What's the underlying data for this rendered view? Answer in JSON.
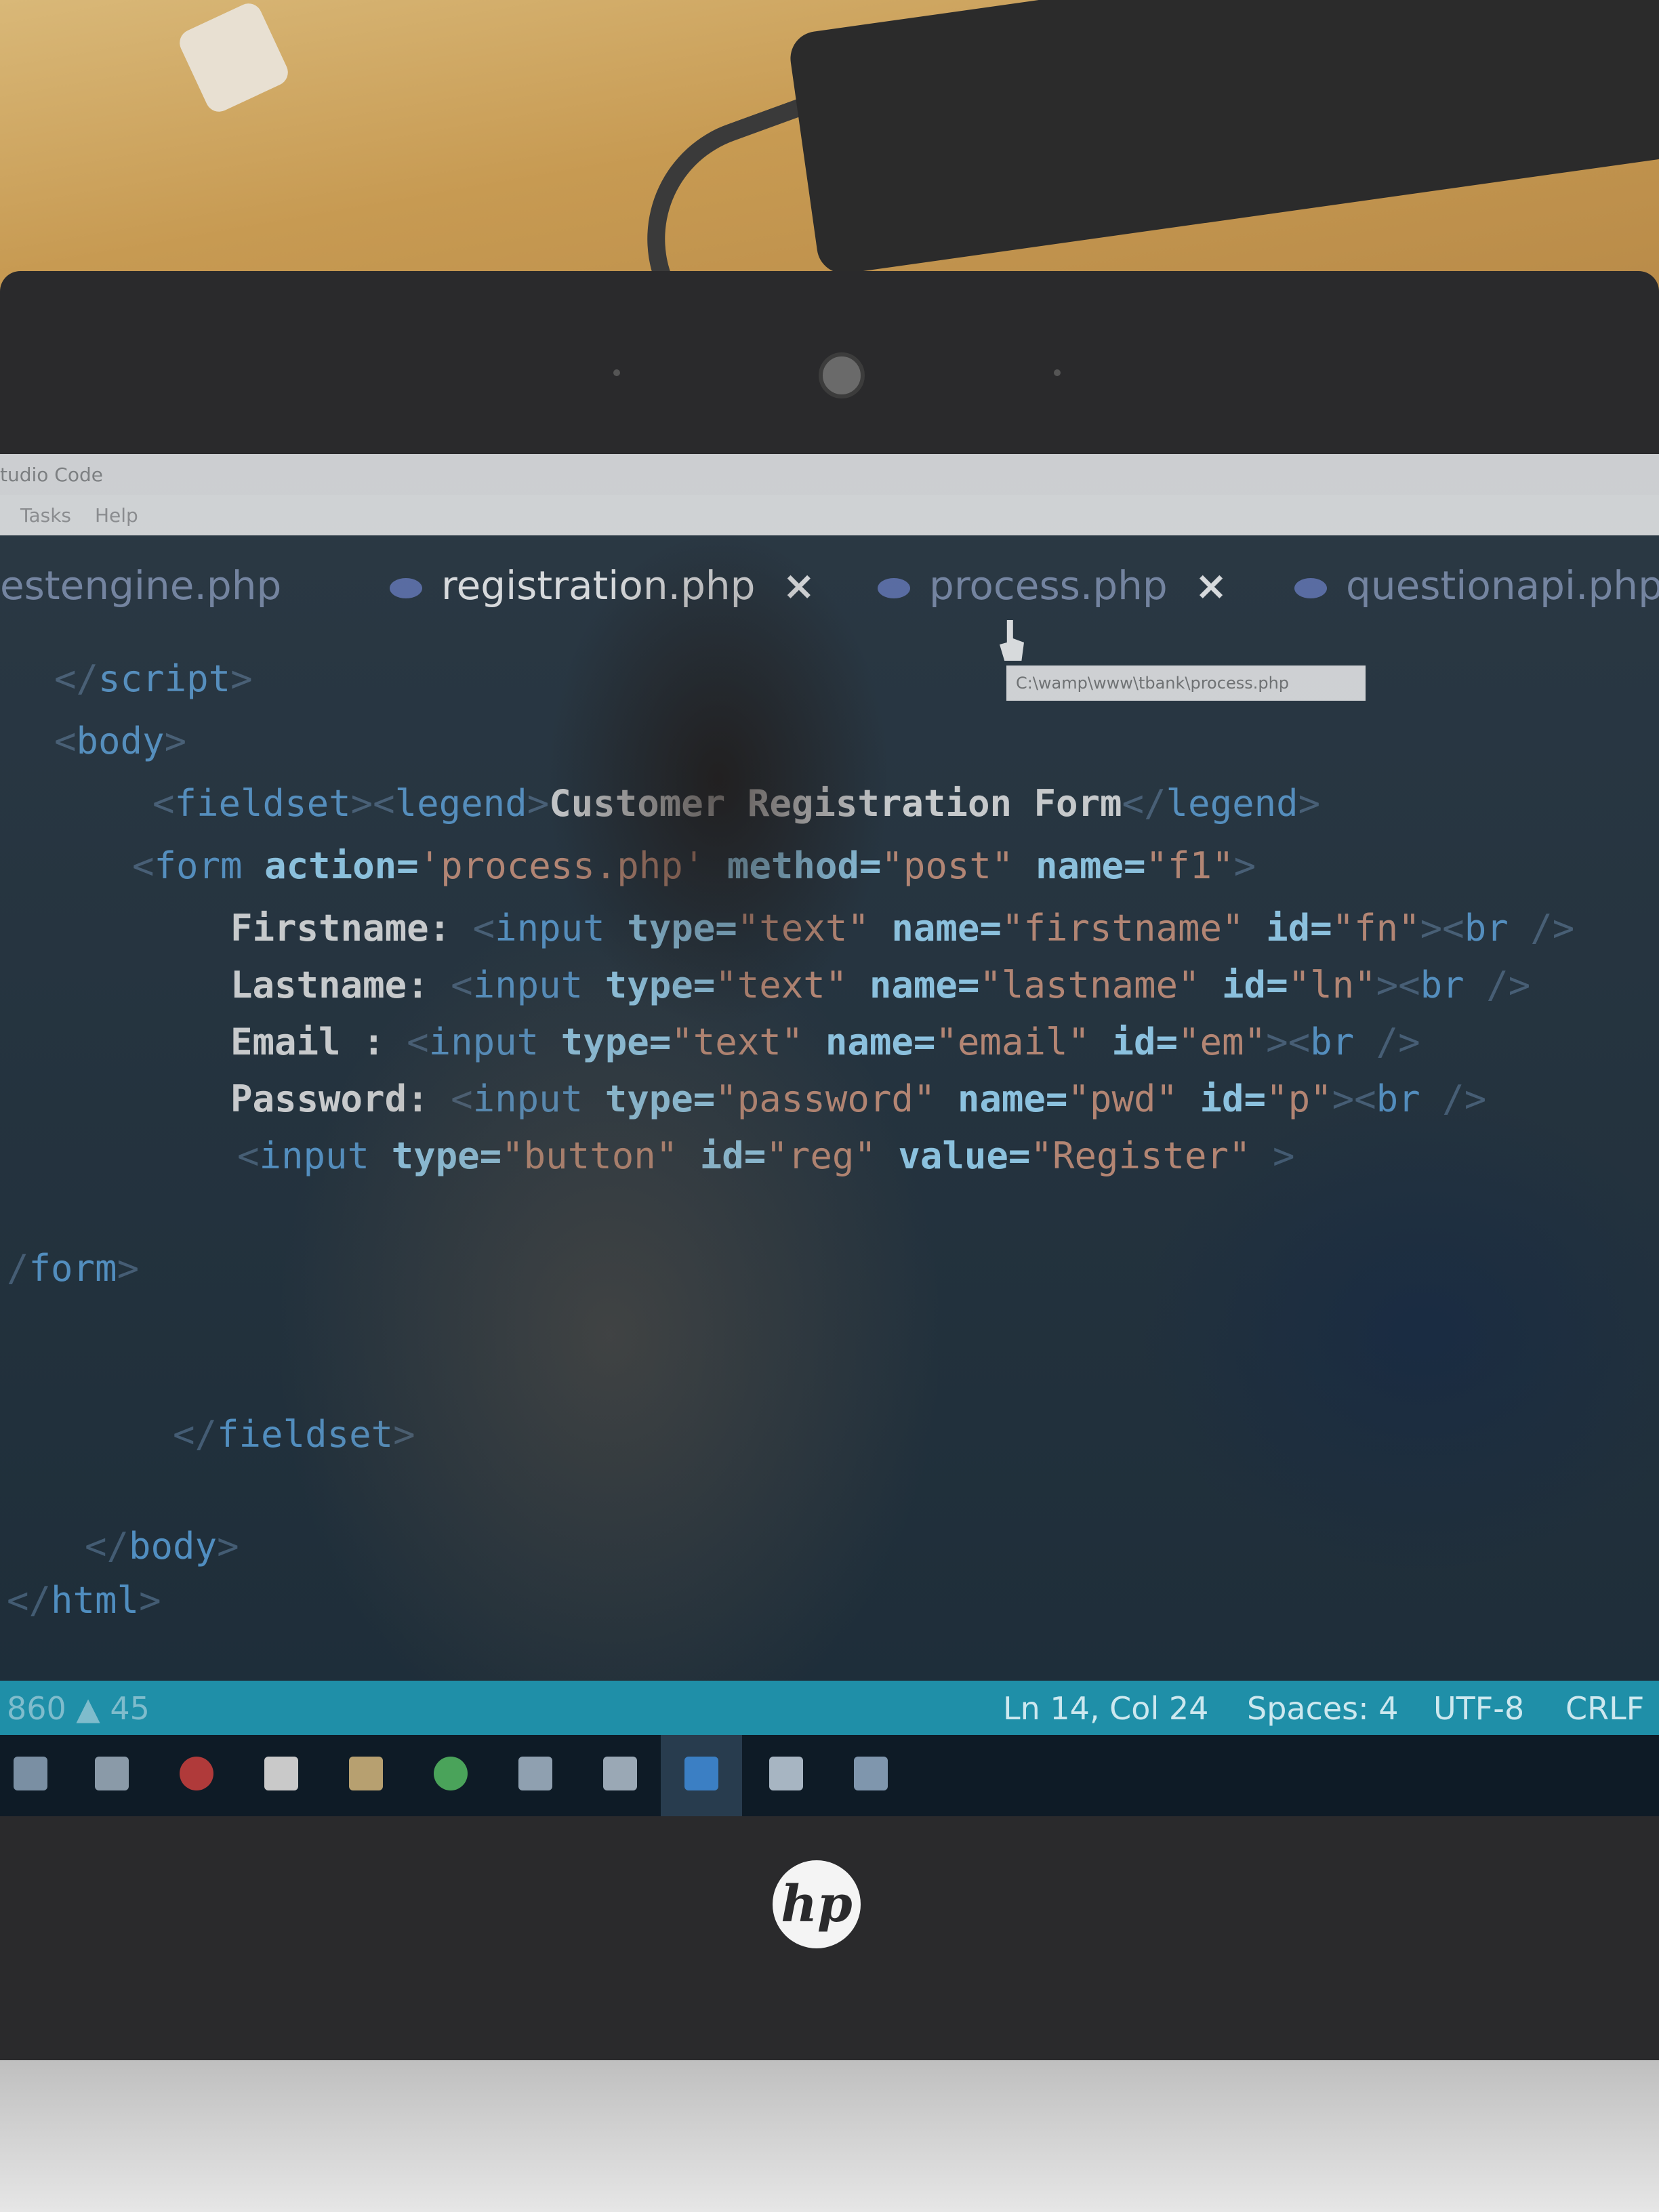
{
  "window": {
    "title": "tudio Code"
  },
  "menu": {
    "items": [
      "Tasks",
      "Help"
    ]
  },
  "tabs": [
    {
      "label": "estengine.php",
      "active": false
    },
    {
      "label": "registration.php",
      "active": true,
      "close": "×"
    },
    {
      "label": "process.php",
      "active": false,
      "close": "×"
    },
    {
      "label": "questionapi.php",
      "active": false
    }
  ],
  "tooltip": "C:\\wamp\\www\\tbank\\process.php",
  "code": {
    "l1": {
      "a": "</",
      "b": "script",
      "c": ">"
    },
    "l2": {
      "a": "<",
      "b": "body",
      "c": ">"
    },
    "l3": {
      "a": "<",
      "b": "fieldset",
      "c": "><",
      "d": "legend",
      "e": ">",
      "f": "Customer Registration Form",
      "g": "</",
      "h": "legend",
      "i": ">"
    },
    "l4": {
      "a": "<",
      "b": "form",
      "c": " action=",
      "d": "'process.php'",
      "e": " method=",
      "f": "\"post\"",
      "g": " name=",
      "h": "\"f1\"",
      "i": ">"
    },
    "l5": {
      "a": "Firstname: ",
      "b": "<",
      "c": "input",
      "d": " type=",
      "e": "\"text\"",
      "f": " name=",
      "g": "\"firstname\"",
      "h": " id=",
      "i": "\"fn\"",
      "j": "><",
      "k": "br",
      "l": " />"
    },
    "l6": {
      "a": "Lastname: ",
      "b": "<",
      "c": "input",
      "d": " type=",
      "e": "\"text\"",
      "f": " name=",
      "g": "\"lastname\"",
      "h": " id=",
      "i": "\"ln\"",
      "j": "><",
      "k": "br",
      "l": " />"
    },
    "l7": {
      "a": "Email : ",
      "b": "<",
      "c": "input",
      "d": " type=",
      "e": "\"text\"",
      "f": " name=",
      "g": "\"email\"",
      "h": " id=",
      "i": "\"em\"",
      "j": "><",
      "k": "br",
      "l": " />"
    },
    "l8": {
      "a": "Password: ",
      "b": "<",
      "c": "input",
      "d": " type=",
      "e": "\"password\"",
      "f": " name=",
      "g": "\"pwd\"",
      "h": " id=",
      "i": "\"p\"",
      "j": "><",
      "k": "br",
      "l": " />"
    },
    "l9": {
      "a": "<",
      "b": "input",
      "c": " type=",
      "d": "\"button\"",
      "e": " id=",
      "f": "\"reg\"",
      "g": " value=",
      "h": "\"Register\"",
      "i": " >"
    },
    "l10": {
      "a": "/",
      "b": "form",
      "c": ">"
    },
    "l11": {
      "a": "</",
      "b": "fieldset",
      "c": ">"
    },
    "l12": {
      "a": "</",
      "b": "body",
      "c": ">"
    },
    "l13": {
      "a": "</",
      "b": "html",
      "c": ">"
    }
  },
  "status": {
    "problems": "860 ▲ 45",
    "position": "Ln 14, Col 24",
    "spaces": "Spaces: 4",
    "encoding": "UTF-8",
    "eol": "CRLF"
  },
  "laptop": {
    "brand": "hp"
  },
  "colors": {
    "status_bar": "#1f8fa8",
    "tag": "#569cd6",
    "attribute": "#9cdcfe",
    "string": "#ce9178"
  }
}
